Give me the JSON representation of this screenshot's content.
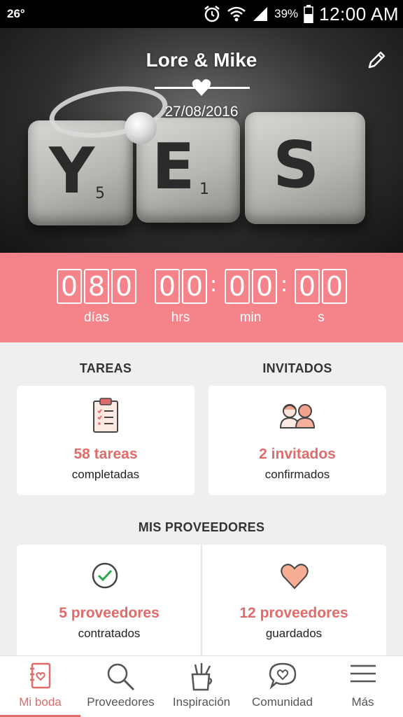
{
  "status_bar": {
    "temperature": "26°",
    "battery": "39%",
    "time": "12:00 AM"
  },
  "hero": {
    "couple": "Lore & Mike",
    "date": "27/08/2016",
    "photo_letters": [
      "Y",
      "E",
      "S"
    ],
    "photo_numbers": [
      "5",
      "1"
    ]
  },
  "countdown": {
    "days_digits": [
      "0",
      "8",
      "0"
    ],
    "hours_digits": [
      "0",
      "0"
    ],
    "minutes_digits": [
      "0",
      "0"
    ],
    "seconds_digits": [
      "0",
      "0"
    ],
    "separator": ":",
    "labels": {
      "days": "días",
      "hours": "hrs",
      "minutes": "min",
      "seconds": "s"
    }
  },
  "tasks": {
    "title": "TAREAS",
    "count": "58 tareas",
    "caption": "completadas"
  },
  "guests": {
    "title": "INVITADOS",
    "count": "2 invitados",
    "caption": "confirmados"
  },
  "vendors": {
    "title": "MIS PROVEEDORES",
    "hired_count": "5 proveedores",
    "hired_caption": "contratados",
    "saved_count": "12 proveedores",
    "saved_caption": "guardados"
  },
  "nav": {
    "items": [
      {
        "label": "Mi boda",
        "icon": "notebook-icon",
        "active": true
      },
      {
        "label": "Proveedores",
        "icon": "search-icon",
        "active": false
      },
      {
        "label": "Inspiración",
        "icon": "pencil-cup-icon",
        "active": false
      },
      {
        "label": "Comunidad",
        "icon": "chat-heart-icon",
        "active": false
      },
      {
        "label": "Más",
        "icon": "menu-icon",
        "active": false
      }
    ]
  },
  "colors": {
    "accent": "#f5848a",
    "accent_text": "#e06b6b",
    "background": "#efefef"
  }
}
